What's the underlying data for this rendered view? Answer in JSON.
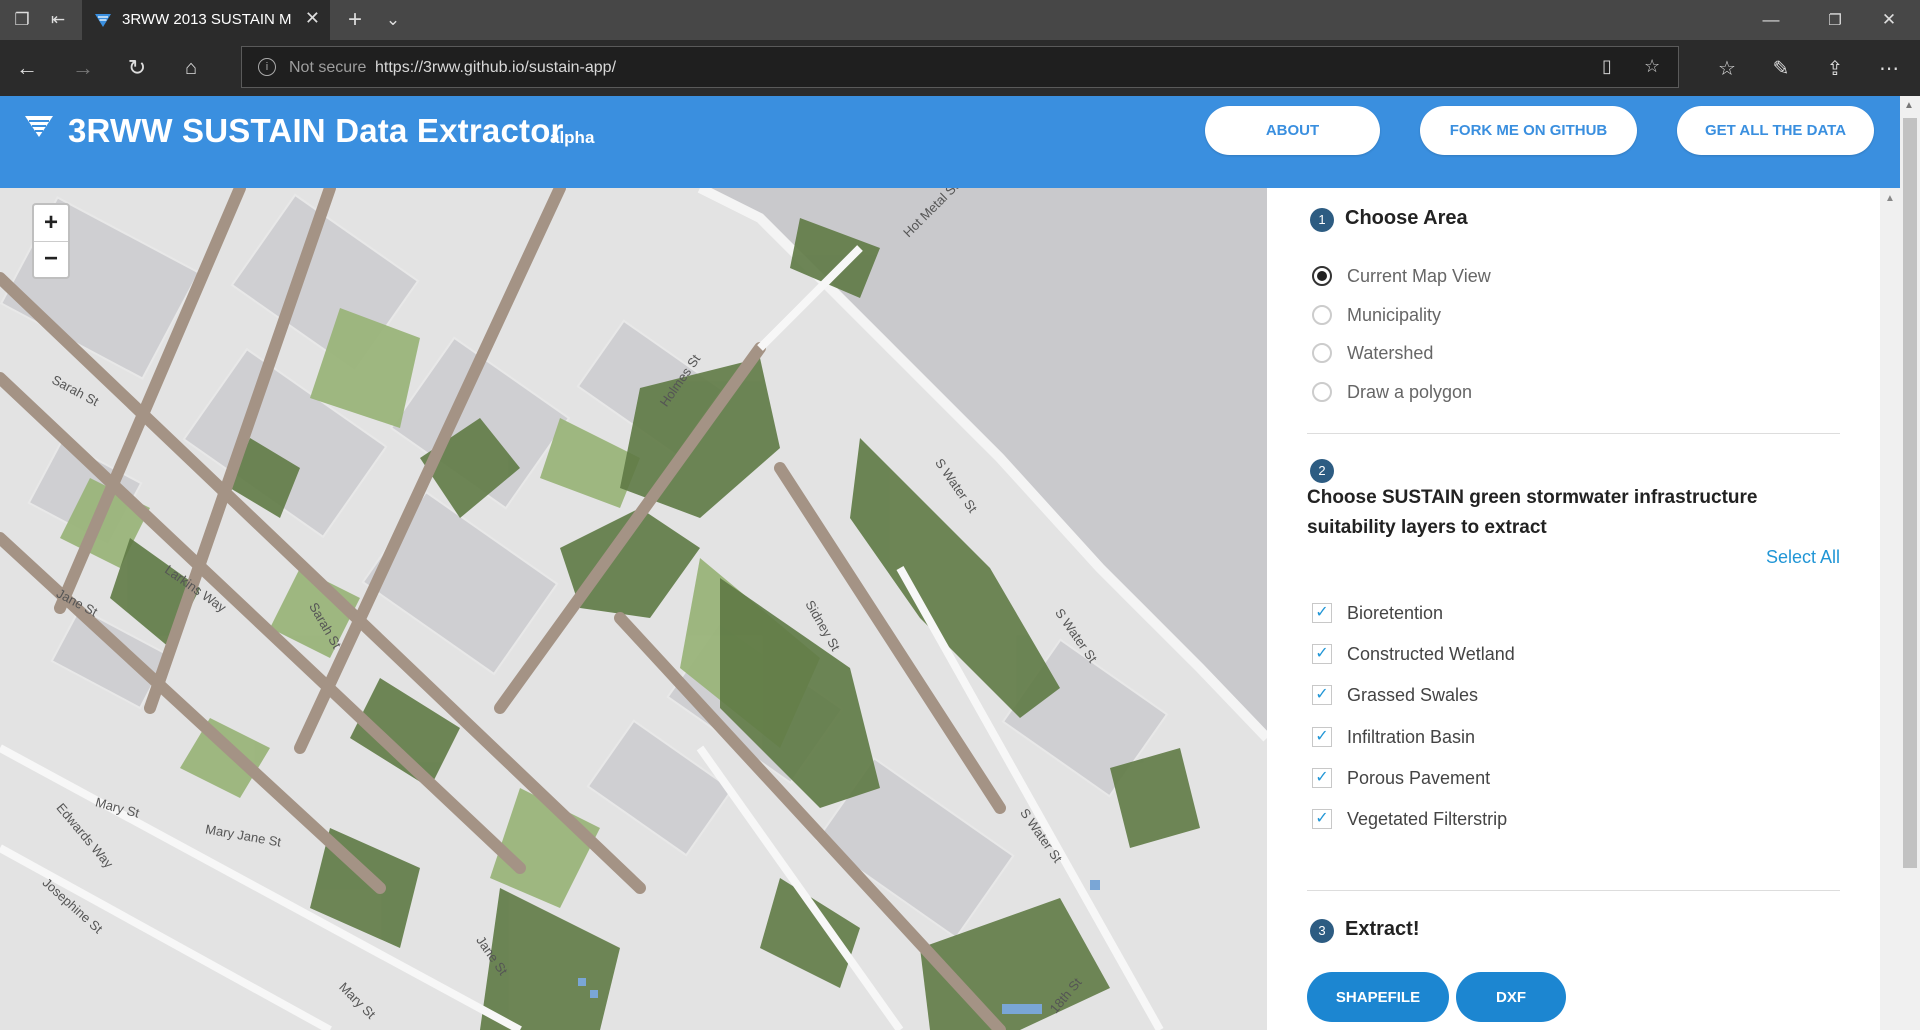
{
  "browser": {
    "tab_title": "3RWW 2013 SUSTAIN M",
    "security_label": "Not secure",
    "url": "https://3rww.github.io/sustain-app/"
  },
  "app": {
    "title": "3RWW SUSTAIN Data Extractor",
    "title_suffix": "alpha",
    "nav": {
      "about": "ABOUT",
      "fork": "FORK ME ON GITHUB",
      "get_all": "GET ALL THE DATA"
    }
  },
  "map": {
    "zoom_in": "+",
    "zoom_out": "−",
    "street_labels": [
      "Hot Metal St",
      "Sarah St",
      "Jane St",
      "Larkins Way",
      "Mary St",
      "Mary Jane St",
      "Edwards Way",
      "Josephine St",
      "Holmes St",
      "S Water St",
      "S Water St",
      "Sarah St",
      "Jane St",
      "Mary St",
      "Sidney St",
      "S Water St",
      "18th St"
    ]
  },
  "panel": {
    "step1": {
      "num": "1",
      "title": "Choose Area",
      "options": [
        "Current Map View",
        "Municipality",
        "Watershed",
        "Draw a polygon"
      ],
      "selected": "Current Map View"
    },
    "step2": {
      "num": "2",
      "title_line1": "Choose SUSTAIN green stormwater infrastructure",
      "title_line2": "suitability layers to extract",
      "select_all": "Select All",
      "layers": [
        "Bioretention",
        "Constructed Wetland",
        "Grassed Swales",
        "Infiltration Basin",
        "Porous Pavement",
        "Vegetated Filterstrip"
      ]
    },
    "step3": {
      "num": "3",
      "title": "Extract!",
      "buttons": [
        "SHAPEFILE",
        "DXF"
      ]
    }
  },
  "colors": {
    "header_blue": "#3a8fdf",
    "button_blue": "#1c86d1",
    "step_circle": "#2d5c82",
    "map_green_dark": "#5f7a45",
    "map_green_light": "#9ab47a",
    "map_road": "#a49385"
  }
}
